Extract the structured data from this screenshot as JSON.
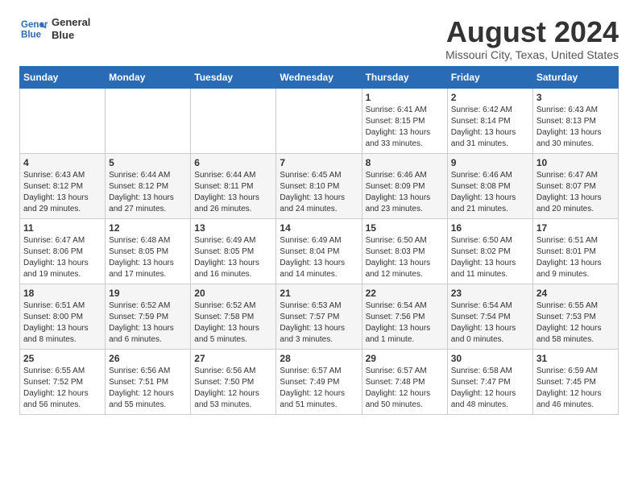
{
  "header": {
    "logo_line1": "General",
    "logo_line2": "Blue",
    "month_title": "August 2024",
    "location": "Missouri City, Texas, United States"
  },
  "weekdays": [
    "Sunday",
    "Monday",
    "Tuesday",
    "Wednesday",
    "Thursday",
    "Friday",
    "Saturday"
  ],
  "weeks": [
    [
      {
        "day": "",
        "info": ""
      },
      {
        "day": "",
        "info": ""
      },
      {
        "day": "",
        "info": ""
      },
      {
        "day": "",
        "info": ""
      },
      {
        "day": "1",
        "info": "Sunrise: 6:41 AM\nSunset: 8:15 PM\nDaylight: 13 hours\nand 33 minutes."
      },
      {
        "day": "2",
        "info": "Sunrise: 6:42 AM\nSunset: 8:14 PM\nDaylight: 13 hours\nand 31 minutes."
      },
      {
        "day": "3",
        "info": "Sunrise: 6:43 AM\nSunset: 8:13 PM\nDaylight: 13 hours\nand 30 minutes."
      }
    ],
    [
      {
        "day": "4",
        "info": "Sunrise: 6:43 AM\nSunset: 8:12 PM\nDaylight: 13 hours\nand 29 minutes."
      },
      {
        "day": "5",
        "info": "Sunrise: 6:44 AM\nSunset: 8:12 PM\nDaylight: 13 hours\nand 27 minutes."
      },
      {
        "day": "6",
        "info": "Sunrise: 6:44 AM\nSunset: 8:11 PM\nDaylight: 13 hours\nand 26 minutes."
      },
      {
        "day": "7",
        "info": "Sunrise: 6:45 AM\nSunset: 8:10 PM\nDaylight: 13 hours\nand 24 minutes."
      },
      {
        "day": "8",
        "info": "Sunrise: 6:46 AM\nSunset: 8:09 PM\nDaylight: 13 hours\nand 23 minutes."
      },
      {
        "day": "9",
        "info": "Sunrise: 6:46 AM\nSunset: 8:08 PM\nDaylight: 13 hours\nand 21 minutes."
      },
      {
        "day": "10",
        "info": "Sunrise: 6:47 AM\nSunset: 8:07 PM\nDaylight: 13 hours\nand 20 minutes."
      }
    ],
    [
      {
        "day": "11",
        "info": "Sunrise: 6:47 AM\nSunset: 8:06 PM\nDaylight: 13 hours\nand 19 minutes."
      },
      {
        "day": "12",
        "info": "Sunrise: 6:48 AM\nSunset: 8:05 PM\nDaylight: 13 hours\nand 17 minutes."
      },
      {
        "day": "13",
        "info": "Sunrise: 6:49 AM\nSunset: 8:05 PM\nDaylight: 13 hours\nand 16 minutes."
      },
      {
        "day": "14",
        "info": "Sunrise: 6:49 AM\nSunset: 8:04 PM\nDaylight: 13 hours\nand 14 minutes."
      },
      {
        "day": "15",
        "info": "Sunrise: 6:50 AM\nSunset: 8:03 PM\nDaylight: 13 hours\nand 12 minutes."
      },
      {
        "day": "16",
        "info": "Sunrise: 6:50 AM\nSunset: 8:02 PM\nDaylight: 13 hours\nand 11 minutes."
      },
      {
        "day": "17",
        "info": "Sunrise: 6:51 AM\nSunset: 8:01 PM\nDaylight: 13 hours\nand 9 minutes."
      }
    ],
    [
      {
        "day": "18",
        "info": "Sunrise: 6:51 AM\nSunset: 8:00 PM\nDaylight: 13 hours\nand 8 minutes."
      },
      {
        "day": "19",
        "info": "Sunrise: 6:52 AM\nSunset: 7:59 PM\nDaylight: 13 hours\nand 6 minutes."
      },
      {
        "day": "20",
        "info": "Sunrise: 6:52 AM\nSunset: 7:58 PM\nDaylight: 13 hours\nand 5 minutes."
      },
      {
        "day": "21",
        "info": "Sunrise: 6:53 AM\nSunset: 7:57 PM\nDaylight: 13 hours\nand 3 minutes."
      },
      {
        "day": "22",
        "info": "Sunrise: 6:54 AM\nSunset: 7:56 PM\nDaylight: 13 hours\nand 1 minute."
      },
      {
        "day": "23",
        "info": "Sunrise: 6:54 AM\nSunset: 7:54 PM\nDaylight: 13 hours\nand 0 minutes."
      },
      {
        "day": "24",
        "info": "Sunrise: 6:55 AM\nSunset: 7:53 PM\nDaylight: 12 hours\nand 58 minutes."
      }
    ],
    [
      {
        "day": "25",
        "info": "Sunrise: 6:55 AM\nSunset: 7:52 PM\nDaylight: 12 hours\nand 56 minutes."
      },
      {
        "day": "26",
        "info": "Sunrise: 6:56 AM\nSunset: 7:51 PM\nDaylight: 12 hours\nand 55 minutes."
      },
      {
        "day": "27",
        "info": "Sunrise: 6:56 AM\nSunset: 7:50 PM\nDaylight: 12 hours\nand 53 minutes."
      },
      {
        "day": "28",
        "info": "Sunrise: 6:57 AM\nSunset: 7:49 PM\nDaylight: 12 hours\nand 51 minutes."
      },
      {
        "day": "29",
        "info": "Sunrise: 6:57 AM\nSunset: 7:48 PM\nDaylight: 12 hours\nand 50 minutes."
      },
      {
        "day": "30",
        "info": "Sunrise: 6:58 AM\nSunset: 7:47 PM\nDaylight: 12 hours\nand 48 minutes."
      },
      {
        "day": "31",
        "info": "Sunrise: 6:59 AM\nSunset: 7:45 PM\nDaylight: 12 hours\nand 46 minutes."
      }
    ]
  ]
}
